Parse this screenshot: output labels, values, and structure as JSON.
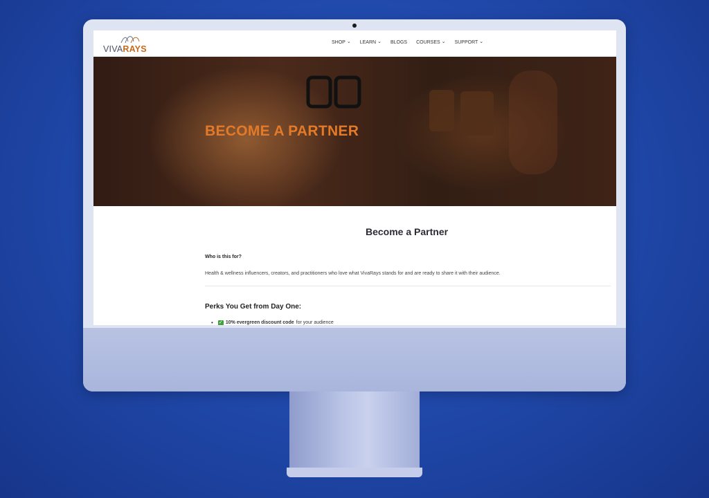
{
  "brand": {
    "logo_text_main": "VIVA",
    "logo_text_accent": "RAYS",
    "accent_color": "#e27a2a"
  },
  "nav": {
    "items": [
      {
        "label": "SHOP",
        "has_dropdown": true
      },
      {
        "label": "LEARN",
        "has_dropdown": true
      },
      {
        "label": "BLOGS",
        "has_dropdown": false
      },
      {
        "label": "COURSES",
        "has_dropdown": true
      },
      {
        "label": "SUPPORT",
        "has_dropdown": true
      }
    ]
  },
  "hero": {
    "title": "BECOME A PARTNER"
  },
  "content": {
    "section_title": "Become a Partner",
    "who_heading": "Who is this for?",
    "who_description": "Health & wellness influencers, creators, and practitioners who love what VivaRays stands for and are ready to share it with their audience.",
    "perks_heading": "Perks You Get from Day One:",
    "perks": [
      {
        "icon": "check-icon",
        "bold": "10% evergreen discount code",
        "rest": " for your audience"
      }
    ]
  }
}
